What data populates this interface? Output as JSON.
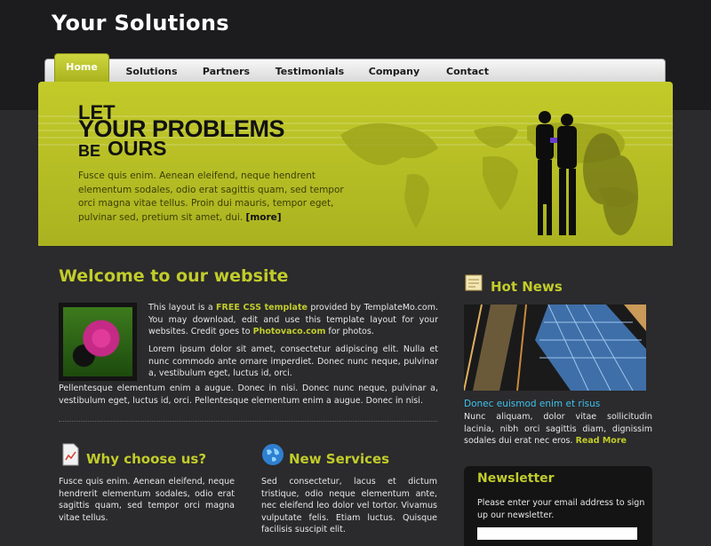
{
  "site": {
    "title": "Your Solutions"
  },
  "nav": {
    "items": [
      {
        "label": "Home"
      },
      {
        "label": "Solutions"
      },
      {
        "label": "Partners"
      },
      {
        "label": "Testimonials"
      },
      {
        "label": "Company"
      },
      {
        "label": "Contact"
      }
    ]
  },
  "hero": {
    "line1": "LET",
    "line2": "YOUR PROBLEMS",
    "line3a": "BE",
    "line3b": "OURS",
    "text": "Fusce quis enim. Aenean eleifend, neque hendrent elementum sodales, odio erat sagittis quam, sed tempor orci magna vitae tellus. Proin dui mauris, tempor eget, pulvinar sed, pretium sit amet, dui.",
    "more": "[more]"
  },
  "welcome": {
    "title": "Welcome to our website",
    "p1_a": "This layout is a ",
    "p1_link1": "FREE CSS template",
    "p1_b": " provided by TemplateMo.com. You may download, edit and use this template layout for your websites. Credit goes to ",
    "p1_link2": "Photovaco.com",
    "p1_c": " for photos.",
    "p2": "Lorem ipsum dolor sit amet, consectetur adipiscing elit. Nulla et nunc commodo ante ornare imperdiet. Donec nunc neque, pulvinar a, vestibulum eget, luctus id, orci.",
    "p3": "Pellentesque elementum enim a augue. Donec in nisi. Donec nunc neque, pulvinar a, vestibulum eget, luctus id, orci. Pellentesque elementum enim a augue. Donec in nisi."
  },
  "why": {
    "title": "Why choose us?",
    "icon": "document-icon",
    "text": "Fusce quis enim. Aenean eleifend, neque hendrerit elementum sodales, odio erat sagittis quam, sed tempor orci magna vitae tellus."
  },
  "services": {
    "title": "New Services",
    "icon": "globe-icon",
    "text": "Sed consectetur, lacus et dictum tristique, odio neque elementum ante, nec eleifend leo dolor vel tortor. Vivamus vulputate felis. Etiam luctus. Quisque facilisis suscipit elit."
  },
  "news": {
    "title": "Hot News",
    "icon": "note-icon",
    "link": "Donec euismod enim et risus",
    "text": "Nunc aliquam, dolor vitae sollicitudin lacinia, nibh orci sagittis diam, dignissim sodales dui erat nec eros.",
    "more": "Read More"
  },
  "newsletter": {
    "title": "Newsletter",
    "text": "Please enter your email address to sign up our newsletter.",
    "placeholder": ""
  },
  "colors": {
    "accent": "#c1cc2b",
    "background": "#2b2a2c",
    "link": "#3cc3ee"
  }
}
